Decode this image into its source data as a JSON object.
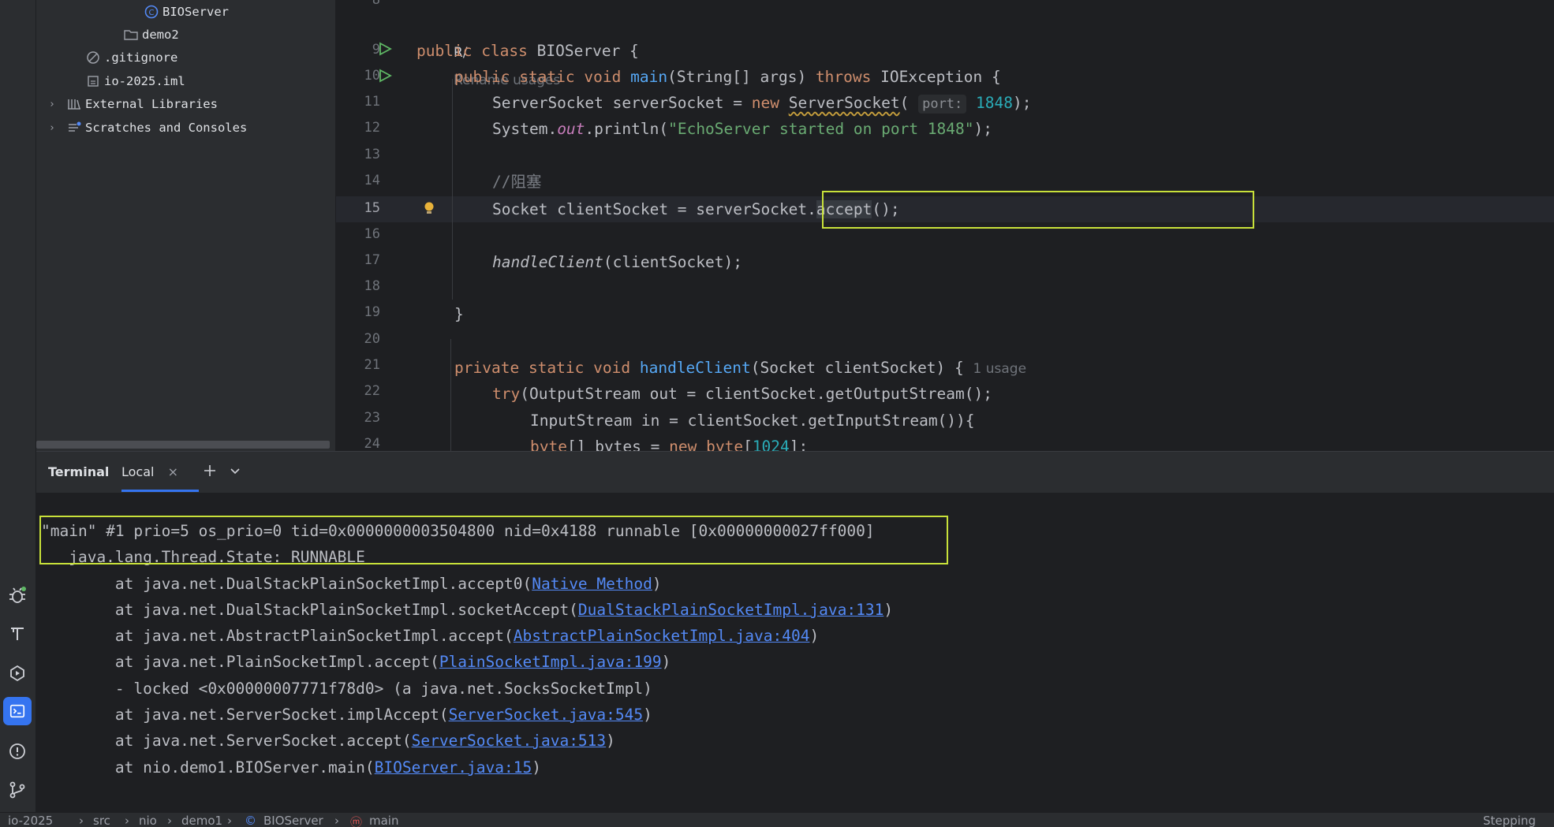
{
  "project_tree": {
    "items": [
      {
        "label": "BIOServer",
        "icon": "java-class-icon"
      },
      {
        "label": "demo2",
        "icon": "folder-icon"
      },
      {
        "label": ".gitignore",
        "icon": "ignore-file-icon"
      },
      {
        "label": "io-2025.iml",
        "icon": "module-file-icon"
      },
      {
        "label": "External Libraries",
        "icon": "library-icon"
      },
      {
        "label": "Scratches and Consoles",
        "icon": "scratches-icon"
      }
    ]
  },
  "editor": {
    "lines": [
      8,
      9,
      10,
      11,
      12,
      13,
      14,
      15,
      16,
      17,
      18,
      19,
      20,
      21,
      22,
      23,
      24
    ],
    "current_line": 15,
    "rename_hint": "Rename usages",
    "usage_hint": "1 usage",
    "param_hint": "port:",
    "code": {
      "l9_a": "public",
      "l9_b": "class",
      "l9_c": "BIOServer {",
      "l10_a": "public",
      "l10_b": "static",
      "l10_c": "void",
      "l10_d": "main",
      "l10_e": "(String[] args) ",
      "l10_f": "throws",
      "l10_g": " IOException {",
      "l11_a": "ServerSocket serverSocket = ",
      "l11_b": "new",
      "l11_c": "ServerSocket",
      "l11_d": "1848",
      "l11_e": ");",
      "l12_a": "System.",
      "l12_b": "out",
      "l12_c": ".println(",
      "l12_d": "\"EchoServer started on port 1848\"",
      "l12_e": ");",
      "l14": "//阻塞",
      "l15_a": "Socket clientSocket = serverSocket.",
      "l15_b": "accept",
      "l15_c": "();",
      "l17_a": "handleClient",
      "l17_b": "(clientSocket);",
      "l19": "}",
      "l21_a": "private",
      "l21_b": "static",
      "l21_c": "void",
      "l21_d": "handleClient",
      "l21_e": "(Socket clientSocket) {",
      "l22_a": "try",
      "l22_b": "(OutputStream out = clientSocket.getOutputStream();",
      "l23": "InputStream in = clientSocket.getInputStream()){",
      "l24_a": "byte",
      "l24_b": "[] bytes = ",
      "l24_c": "new",
      "l24_d": "byte",
      "l24_e": "[",
      "l24_f": "1024",
      "l24_g": "];"
    }
  },
  "terminal": {
    "title": "Terminal",
    "tab_label": "Local",
    "lines": {
      "t1": "\"main\" #1 prio=5 os_prio=0 tid=0x0000000003504800 nid=0x4188 runnable [0x00000000027ff000]",
      "t2": "   java.lang.Thread.State: RUNNABLE",
      "t3_a": "        at java.net.DualStackPlainSocketImpl.accept0(",
      "t3_link": "Native Method",
      "t3_b": ")",
      "t4_a": "        at java.net.DualStackPlainSocketImpl.socketAccept(",
      "t4_link": "DualStackPlainSocketImpl.java:131",
      "t4_b": ")",
      "t5_a": "        at java.net.AbstractPlainSocketImpl.accept(",
      "t5_link": "AbstractPlainSocketImpl.java:404",
      "t5_b": ")",
      "t6_a": "        at java.net.PlainSocketImpl.accept(",
      "t6_link": "PlainSocketImpl.java:199",
      "t6_b": ")",
      "t7": "        - locked <0x00000007771f78d0> (a java.net.SocksSocketImpl)",
      "t8_a": "        at java.net.ServerSocket.implAccept(",
      "t8_link": "ServerSocket.java:545",
      "t8_b": ")",
      "t9_a": "        at java.net.ServerSocket.accept(",
      "t9_link": "ServerSocket.java:513",
      "t9_b": ")",
      "t10_a": "        at nio.demo1.BIOServer.main(",
      "t10_link": "BIOServer.java:15",
      "t10_b": ")"
    }
  },
  "breadcrumbs": [
    "io-2025",
    "src",
    "nio",
    "demo1",
    "BIOServer",
    "main"
  ],
  "status_right": "Stepping",
  "colors": {
    "accent": "#3574f0",
    "highlight_box": "#c8e13a",
    "link": "#548af7"
  }
}
